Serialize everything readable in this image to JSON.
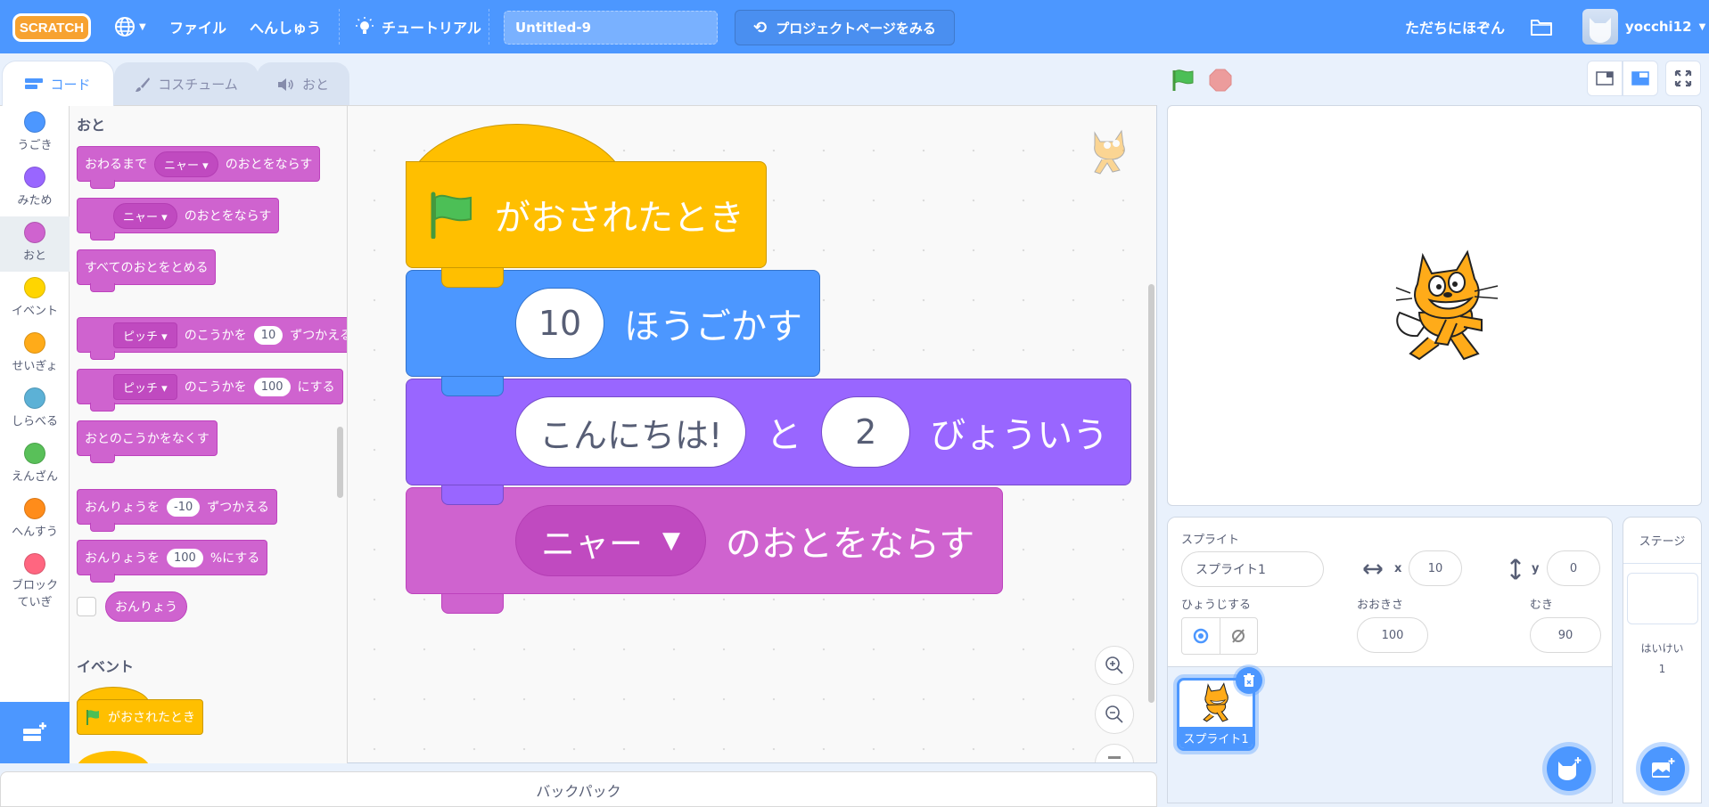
{
  "menubar": {
    "logo": "SCRATCH",
    "language_icon": "globe-icon",
    "file": "ファイル",
    "edit": "へんしゅう",
    "tutorials": "チュートリアル",
    "project_title": "Untitled-9",
    "see_project_page": "プロジェクトページをみる",
    "save_now": "ただちにほぞん",
    "username": "yocchi12"
  },
  "tabs": [
    {
      "label": "コード",
      "icon": "code-icon",
      "active": true
    },
    {
      "label": "コスチューム",
      "icon": "paintbrush-icon",
      "active": false
    },
    {
      "label": "おと",
      "icon": "speaker-icon",
      "active": false
    }
  ],
  "categories": [
    {
      "label": "うごき",
      "color": "#4c97ff"
    },
    {
      "label": "みため",
      "color": "#9966ff"
    },
    {
      "label": "おと",
      "color": "#cf63cf",
      "selected": true
    },
    {
      "label": "イベント",
      "color": "#ffd500"
    },
    {
      "label": "せいぎょ",
      "color": "#ffab19"
    },
    {
      "label": "しらべる",
      "color": "#5cb1d6"
    },
    {
      "label": "えんざん",
      "color": "#59c059"
    },
    {
      "label": "へんすう",
      "color": "#ff8c1a"
    },
    {
      "label": "ブロックていぎ",
      "color": "#ff6680"
    }
  ],
  "palette": {
    "sound_heading": "おと",
    "play_until_done": {
      "pre": "おわるまで",
      "sound": "ニャー",
      "post": "のおとをならす"
    },
    "start_sound": {
      "sound": "ニャー",
      "post": "のおとをならす"
    },
    "stop_all": "すべてのおとをとめる",
    "change_effect": {
      "effect": "ピッチ",
      "mid": "のこうかを",
      "value": "10",
      "post": "ずつかえる"
    },
    "set_effect": {
      "effect": "ピッチ",
      "mid": "のこうかを",
      "value": "100",
      "post": "にする"
    },
    "clear_effects": "おとのこうかをなくす",
    "change_volume": {
      "pre": "おんりょうを",
      "value": "-10",
      "post": "ずつかえる"
    },
    "set_volume": {
      "pre": "おんりょうを",
      "value": "100",
      "post": "%にする"
    },
    "volume_reporter": "おんりょう",
    "events_heading": "イベント",
    "when_flag": "がおされたとき"
  },
  "script": {
    "hat": "がおされたとき",
    "move": {
      "value": "10",
      "label": "ほうごかす"
    },
    "say": {
      "text": "こんにちは!",
      "mid": "と",
      "secs": "2",
      "label": "びょういう"
    },
    "sound": {
      "sound": "ニャー",
      "label": "のおとをならす"
    }
  },
  "backpack": "バックパック",
  "sprite_info": {
    "sprite_label": "スプライト",
    "sprite_name": "スプライト1",
    "x_label": "x",
    "x": "10",
    "y_label": "y",
    "y": "0",
    "show_label": "ひょうじする",
    "size_label": "おおきさ",
    "size": "100",
    "direction_label": "むき",
    "direction": "90"
  },
  "sprites": [
    {
      "name": "スプライト1",
      "selected": true
    }
  ],
  "stage_pane": {
    "title": "ステージ",
    "backdrops_label": "はいけい",
    "backdrops_count": "1"
  }
}
